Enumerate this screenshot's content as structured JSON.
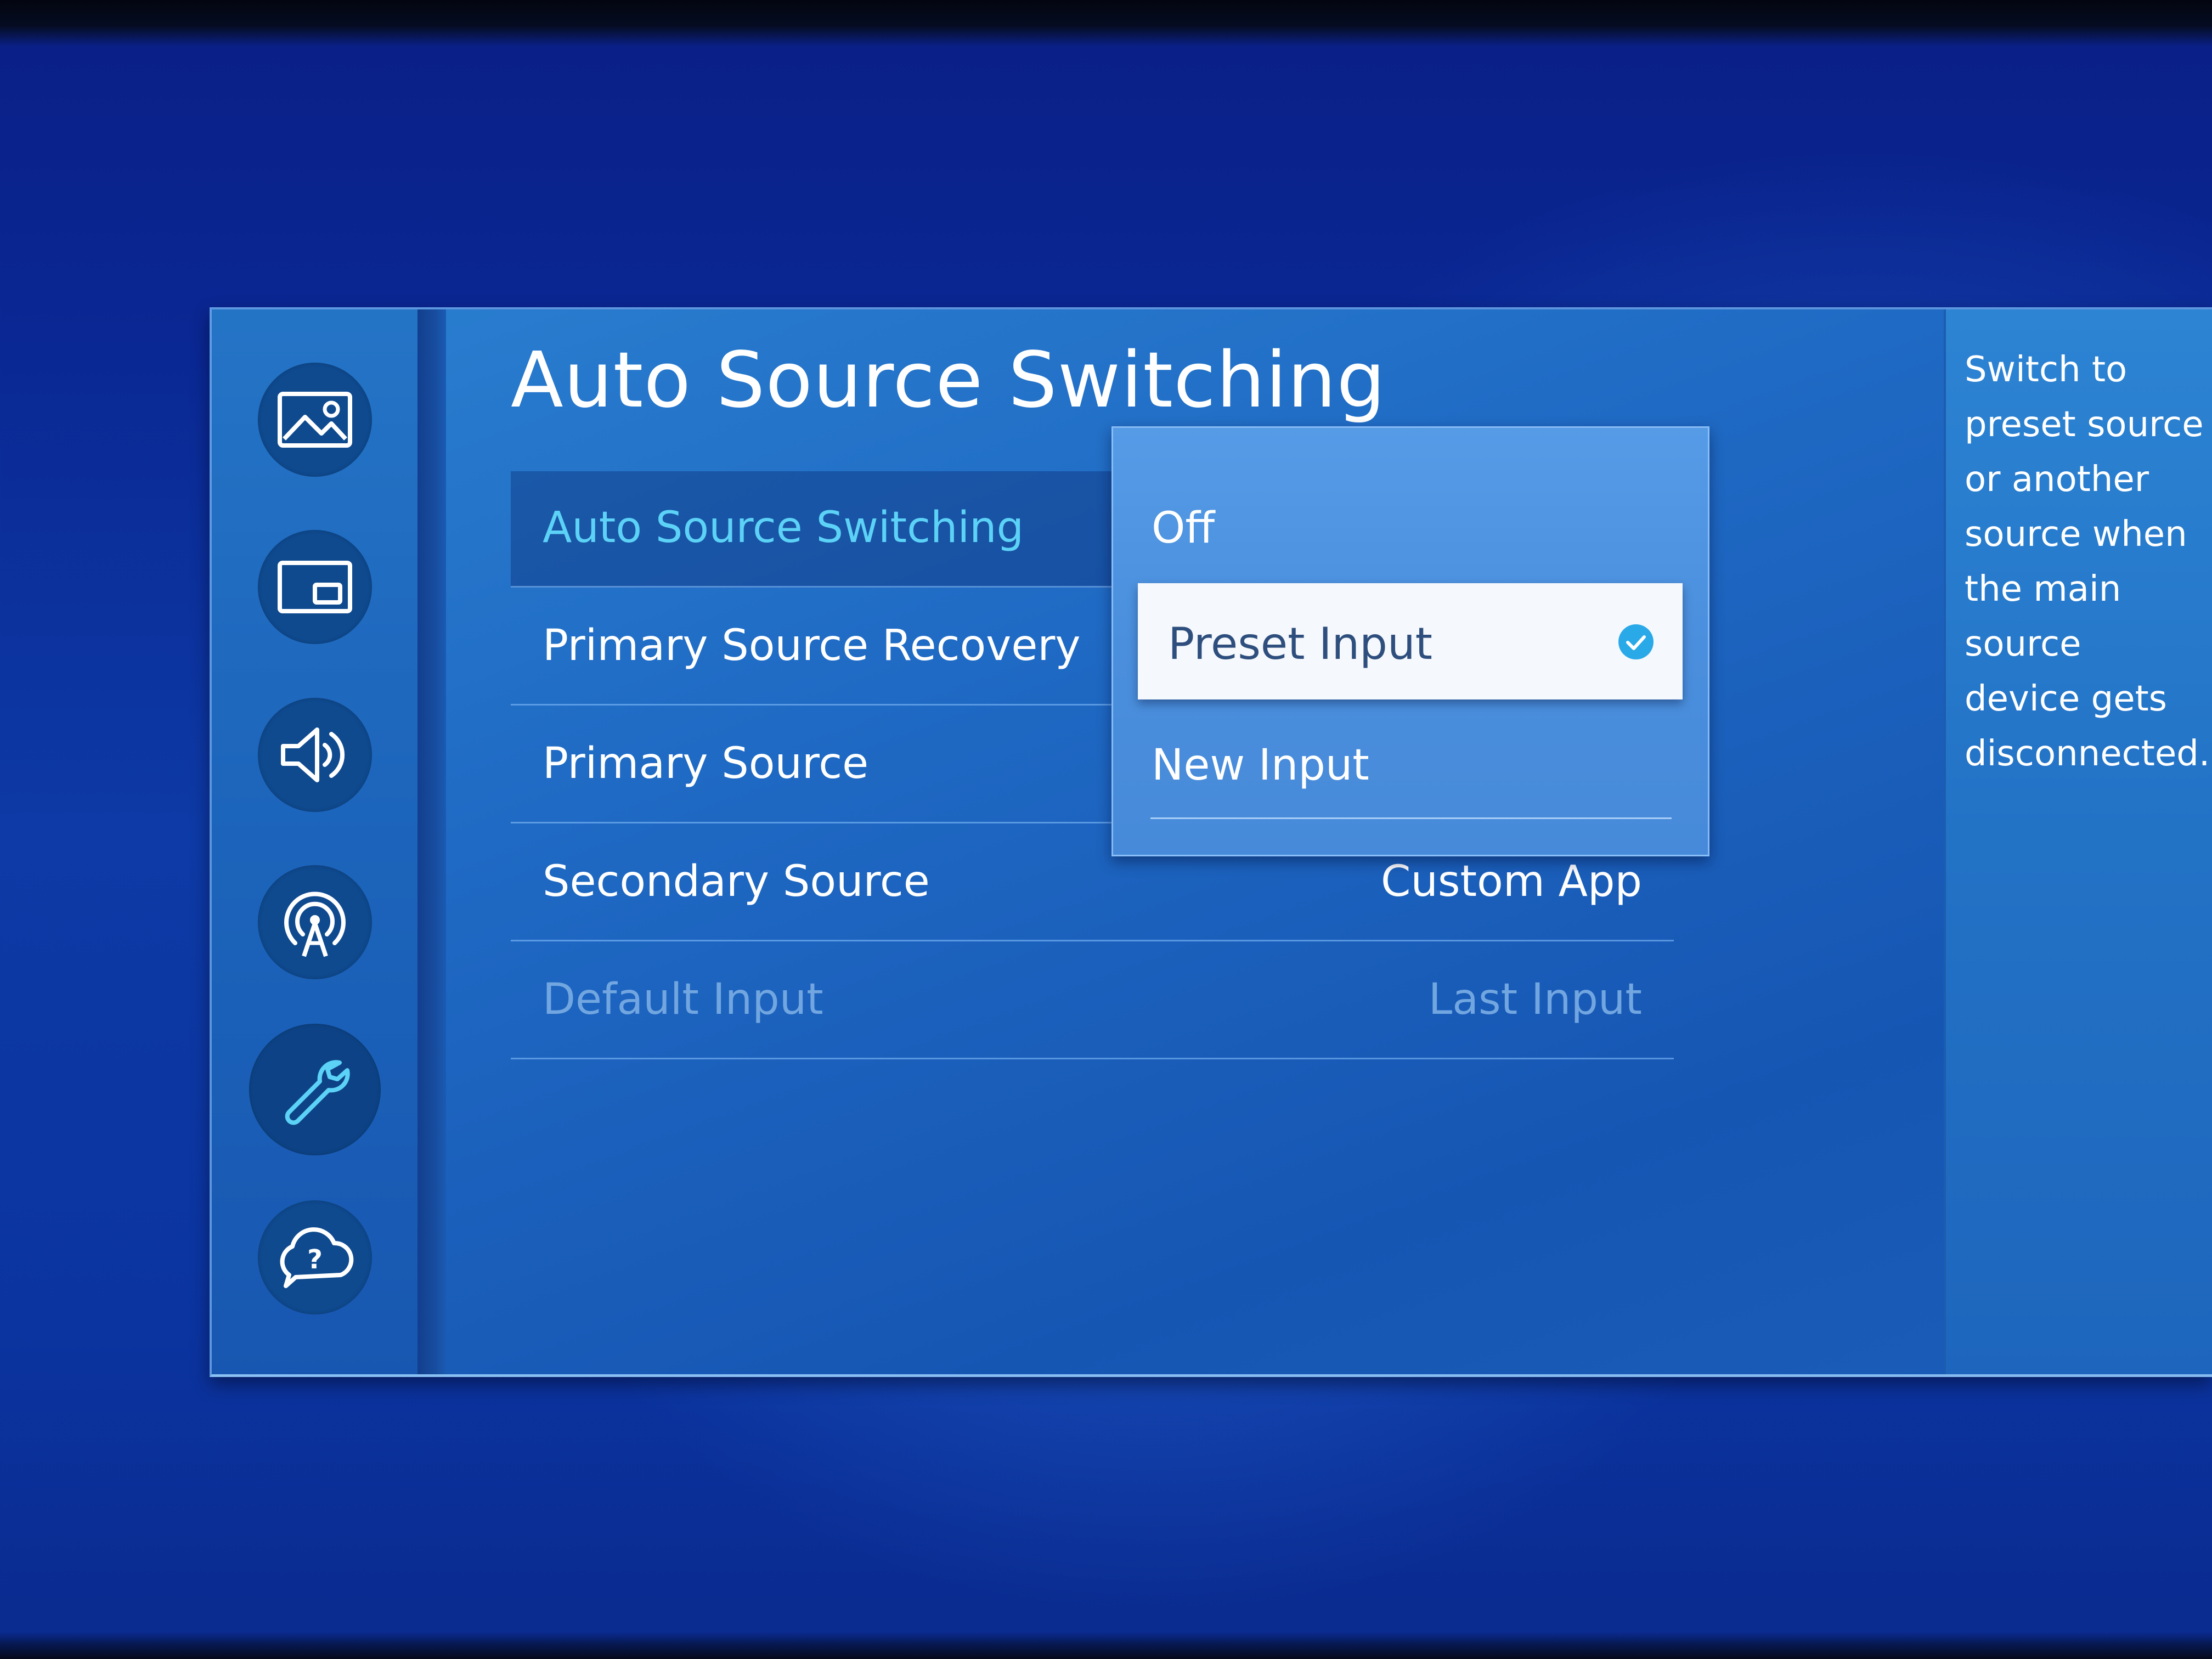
{
  "colors": {
    "focused_label": "#5cd2f7",
    "accent_check": "#2aa9e8",
    "disabled_text": "#72a6e0",
    "panel_blue": "#1f6ac4",
    "dropdown_blue": "#4a8fdd"
  },
  "sidebar": {
    "items": [
      {
        "icon": "picture-icon"
      },
      {
        "icon": "picture-in-picture-icon"
      },
      {
        "icon": "sound-icon"
      },
      {
        "icon": "broadcasting-icon"
      },
      {
        "icon": "general-wrench-icon",
        "selected": true
      },
      {
        "icon": "support-icon"
      }
    ]
  },
  "page": {
    "title": "Auto Source Switching"
  },
  "menu": {
    "rows": [
      {
        "label": "Auto Source Switching",
        "value": "",
        "state": "focused"
      },
      {
        "label": "Primary Source Recovery",
        "value": ""
      },
      {
        "label": "Primary Source",
        "value": ""
      },
      {
        "label": "Secondary Source",
        "value": "Custom App"
      },
      {
        "label": "Default Input",
        "value": "Last Input",
        "state": "disabled"
      }
    ]
  },
  "dropdown": {
    "options": [
      {
        "label": "Off"
      },
      {
        "label": "Preset Input",
        "selected": true
      },
      {
        "label": "New Input"
      }
    ]
  },
  "info": {
    "description": "Switch to preset source or another source when the main source device gets disconnected."
  }
}
